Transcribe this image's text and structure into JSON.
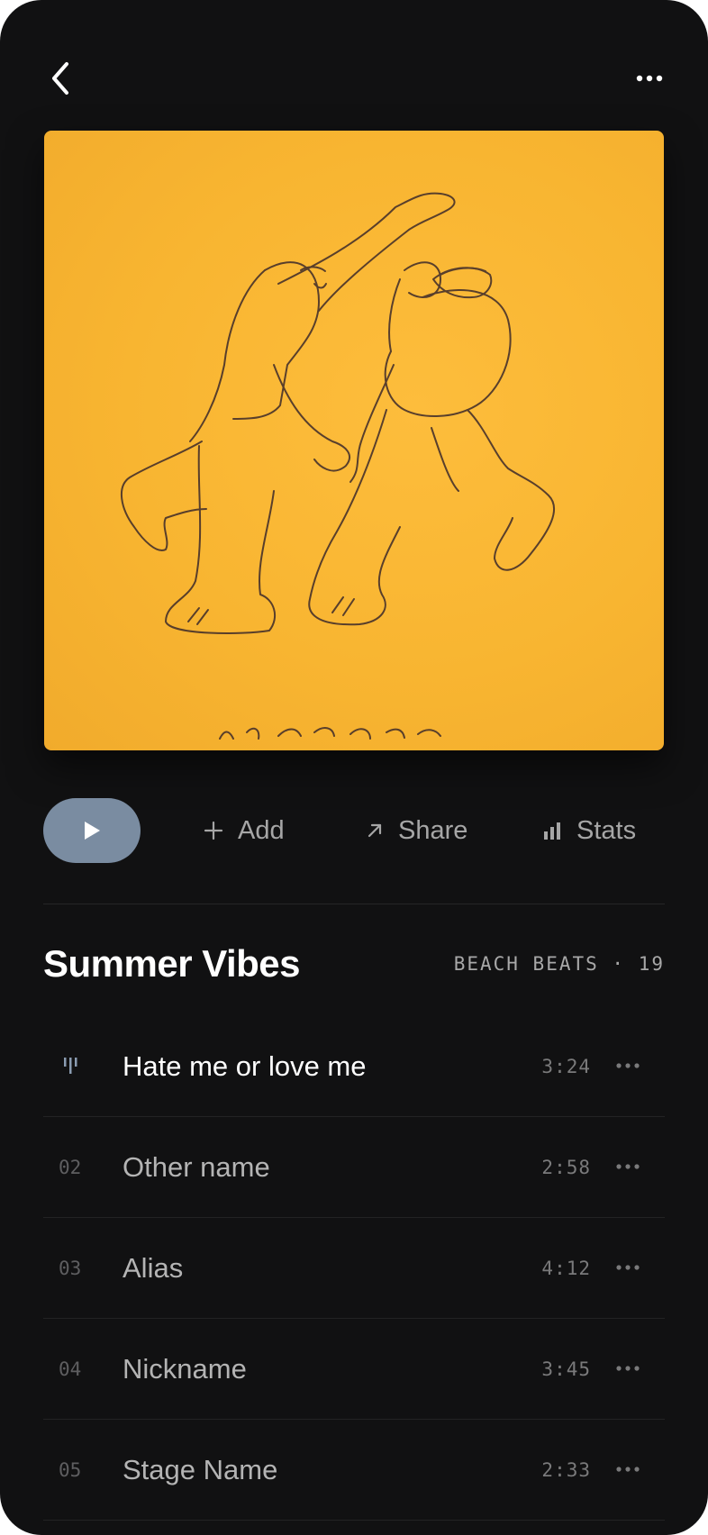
{
  "header": {
    "back_icon": "chevron-left-icon",
    "menu_icon": "more-horizontal-icon"
  },
  "artwork": {
    "description_icon": "album-cover-illustration",
    "background_color": "#f8b531"
  },
  "actions": {
    "play_icon": "play-icon",
    "add_label": "Add",
    "share_label": "Share",
    "stats_label": "Stats"
  },
  "playlist": {
    "title": "Summer Vibes",
    "meta": "BEACH BEATS · 19"
  },
  "tracks": [
    {
      "number": "",
      "name": "Hate me or love me",
      "duration": "3:24",
      "playing": true
    },
    {
      "number": "02",
      "name": "Other name",
      "duration": "2:58",
      "playing": false
    },
    {
      "number": "03",
      "name": "Alias",
      "duration": "4:12",
      "playing": false
    },
    {
      "number": "04",
      "name": "Nickname",
      "duration": "3:45",
      "playing": false
    },
    {
      "number": "05",
      "name": "Stage Name",
      "duration": "2:33",
      "playing": false
    }
  ],
  "colors": {
    "background": "#111112",
    "play_button": "#7a8ca1",
    "text_primary": "#ffffff",
    "text_secondary": "#a6a6a6"
  }
}
